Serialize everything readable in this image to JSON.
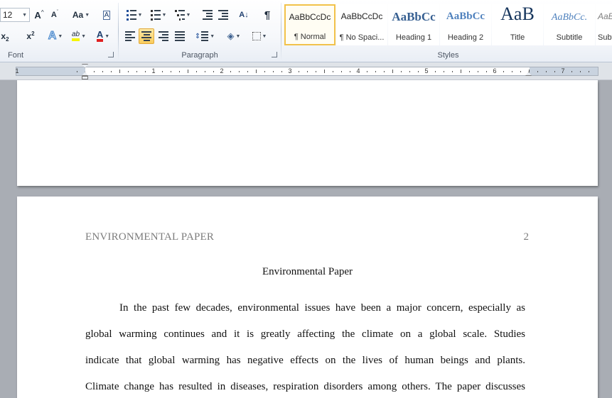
{
  "ribbon": {
    "font": {
      "size_value": "12",
      "grow_label": "A",
      "shrink_label": "A",
      "case_label": "Aa",
      "clear_label": "A",
      "subscript_label": "x",
      "subscript_sub": "2",
      "superscript_label": "x",
      "superscript_sup": "2",
      "text_effects_label": "A",
      "highlight_label": "ab",
      "font_color_label": "A",
      "group_label": "Font"
    },
    "paragraph": {
      "sort_label": "A↓",
      "pilcrow_label": "¶",
      "group_label": "Paragraph"
    },
    "styles": {
      "group_label": "Styles",
      "tiles": [
        {
          "sample": "AaBbCcDc",
          "name": "¶ Normal"
        },
        {
          "sample": "AaBbCcDc",
          "name": "¶ No Spaci..."
        },
        {
          "sample": "AaBbCc",
          "name": "Heading 1"
        },
        {
          "sample": "AaBbCc",
          "name": "Heading 2"
        },
        {
          "sample": "AaB",
          "name": "Title"
        },
        {
          "sample": "AaBbCc.",
          "name": "Subtitle"
        },
        {
          "sample": "AaBbCcL",
          "name": "Subtl"
        }
      ]
    }
  },
  "ruler": {
    "numbers": [
      "1",
      "2",
      "3",
      "4",
      "5",
      "6",
      "7"
    ]
  },
  "document": {
    "header_left": "ENVIRONMENTAL PAPER",
    "header_right": "2",
    "title": "Environmental Paper",
    "lines": [
      "In the past few decades, environmental issues have been a major concern, especially as",
      "global warming continues and it is greatly affecting the climate on a global scale. Studies",
      "indicate that global warming has negative effects on the lives of human beings and plants.",
      "Climate change has resulted in diseases, respiration disorders among others. The paper discusses"
    ]
  },
  "colors": {
    "ribbon_bg": "#f6f8fb",
    "active_button": "#f9cc5c",
    "font_color_underline": "#e02020",
    "highlight_underline": "#f5f500",
    "heading_blue": "#365f91",
    "header_text": "#7c7c7c",
    "workspace_bg": "#a9adb4"
  }
}
